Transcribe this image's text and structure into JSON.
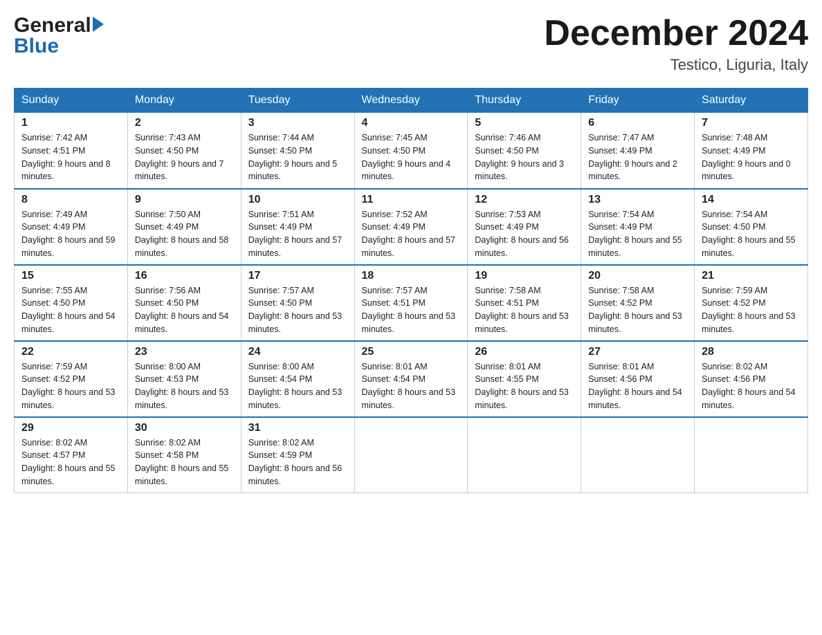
{
  "header": {
    "logo_general": "General",
    "logo_blue": "Blue",
    "month_title": "December 2024",
    "location": "Testico, Liguria, Italy"
  },
  "days_of_week": [
    "Sunday",
    "Monday",
    "Tuesday",
    "Wednesday",
    "Thursday",
    "Friday",
    "Saturday"
  ],
  "weeks": [
    [
      {
        "day": "1",
        "sunrise": "Sunrise: 7:42 AM",
        "sunset": "Sunset: 4:51 PM",
        "daylight": "Daylight: 9 hours and 8 minutes."
      },
      {
        "day": "2",
        "sunrise": "Sunrise: 7:43 AM",
        "sunset": "Sunset: 4:50 PM",
        "daylight": "Daylight: 9 hours and 7 minutes."
      },
      {
        "day": "3",
        "sunrise": "Sunrise: 7:44 AM",
        "sunset": "Sunset: 4:50 PM",
        "daylight": "Daylight: 9 hours and 5 minutes."
      },
      {
        "day": "4",
        "sunrise": "Sunrise: 7:45 AM",
        "sunset": "Sunset: 4:50 PM",
        "daylight": "Daylight: 9 hours and 4 minutes."
      },
      {
        "day": "5",
        "sunrise": "Sunrise: 7:46 AM",
        "sunset": "Sunset: 4:50 PM",
        "daylight": "Daylight: 9 hours and 3 minutes."
      },
      {
        "day": "6",
        "sunrise": "Sunrise: 7:47 AM",
        "sunset": "Sunset: 4:49 PM",
        "daylight": "Daylight: 9 hours and 2 minutes."
      },
      {
        "day": "7",
        "sunrise": "Sunrise: 7:48 AM",
        "sunset": "Sunset: 4:49 PM",
        "daylight": "Daylight: 9 hours and 0 minutes."
      }
    ],
    [
      {
        "day": "8",
        "sunrise": "Sunrise: 7:49 AM",
        "sunset": "Sunset: 4:49 PM",
        "daylight": "Daylight: 8 hours and 59 minutes."
      },
      {
        "day": "9",
        "sunrise": "Sunrise: 7:50 AM",
        "sunset": "Sunset: 4:49 PM",
        "daylight": "Daylight: 8 hours and 58 minutes."
      },
      {
        "day": "10",
        "sunrise": "Sunrise: 7:51 AM",
        "sunset": "Sunset: 4:49 PM",
        "daylight": "Daylight: 8 hours and 57 minutes."
      },
      {
        "day": "11",
        "sunrise": "Sunrise: 7:52 AM",
        "sunset": "Sunset: 4:49 PM",
        "daylight": "Daylight: 8 hours and 57 minutes."
      },
      {
        "day": "12",
        "sunrise": "Sunrise: 7:53 AM",
        "sunset": "Sunset: 4:49 PM",
        "daylight": "Daylight: 8 hours and 56 minutes."
      },
      {
        "day": "13",
        "sunrise": "Sunrise: 7:54 AM",
        "sunset": "Sunset: 4:49 PM",
        "daylight": "Daylight: 8 hours and 55 minutes."
      },
      {
        "day": "14",
        "sunrise": "Sunrise: 7:54 AM",
        "sunset": "Sunset: 4:50 PM",
        "daylight": "Daylight: 8 hours and 55 minutes."
      }
    ],
    [
      {
        "day": "15",
        "sunrise": "Sunrise: 7:55 AM",
        "sunset": "Sunset: 4:50 PM",
        "daylight": "Daylight: 8 hours and 54 minutes."
      },
      {
        "day": "16",
        "sunrise": "Sunrise: 7:56 AM",
        "sunset": "Sunset: 4:50 PM",
        "daylight": "Daylight: 8 hours and 54 minutes."
      },
      {
        "day": "17",
        "sunrise": "Sunrise: 7:57 AM",
        "sunset": "Sunset: 4:50 PM",
        "daylight": "Daylight: 8 hours and 53 minutes."
      },
      {
        "day": "18",
        "sunrise": "Sunrise: 7:57 AM",
        "sunset": "Sunset: 4:51 PM",
        "daylight": "Daylight: 8 hours and 53 minutes."
      },
      {
        "day": "19",
        "sunrise": "Sunrise: 7:58 AM",
        "sunset": "Sunset: 4:51 PM",
        "daylight": "Daylight: 8 hours and 53 minutes."
      },
      {
        "day": "20",
        "sunrise": "Sunrise: 7:58 AM",
        "sunset": "Sunset: 4:52 PM",
        "daylight": "Daylight: 8 hours and 53 minutes."
      },
      {
        "day": "21",
        "sunrise": "Sunrise: 7:59 AM",
        "sunset": "Sunset: 4:52 PM",
        "daylight": "Daylight: 8 hours and 53 minutes."
      }
    ],
    [
      {
        "day": "22",
        "sunrise": "Sunrise: 7:59 AM",
        "sunset": "Sunset: 4:52 PM",
        "daylight": "Daylight: 8 hours and 53 minutes."
      },
      {
        "day": "23",
        "sunrise": "Sunrise: 8:00 AM",
        "sunset": "Sunset: 4:53 PM",
        "daylight": "Daylight: 8 hours and 53 minutes."
      },
      {
        "day": "24",
        "sunrise": "Sunrise: 8:00 AM",
        "sunset": "Sunset: 4:54 PM",
        "daylight": "Daylight: 8 hours and 53 minutes."
      },
      {
        "day": "25",
        "sunrise": "Sunrise: 8:01 AM",
        "sunset": "Sunset: 4:54 PM",
        "daylight": "Daylight: 8 hours and 53 minutes."
      },
      {
        "day": "26",
        "sunrise": "Sunrise: 8:01 AM",
        "sunset": "Sunset: 4:55 PM",
        "daylight": "Daylight: 8 hours and 53 minutes."
      },
      {
        "day": "27",
        "sunrise": "Sunrise: 8:01 AM",
        "sunset": "Sunset: 4:56 PM",
        "daylight": "Daylight: 8 hours and 54 minutes."
      },
      {
        "day": "28",
        "sunrise": "Sunrise: 8:02 AM",
        "sunset": "Sunset: 4:56 PM",
        "daylight": "Daylight: 8 hours and 54 minutes."
      }
    ],
    [
      {
        "day": "29",
        "sunrise": "Sunrise: 8:02 AM",
        "sunset": "Sunset: 4:57 PM",
        "daylight": "Daylight: 8 hours and 55 minutes."
      },
      {
        "day": "30",
        "sunrise": "Sunrise: 8:02 AM",
        "sunset": "Sunset: 4:58 PM",
        "daylight": "Daylight: 8 hours and 55 minutes."
      },
      {
        "day": "31",
        "sunrise": "Sunrise: 8:02 AM",
        "sunset": "Sunset: 4:59 PM",
        "daylight": "Daylight: 8 hours and 56 minutes."
      },
      null,
      null,
      null,
      null
    ]
  ]
}
